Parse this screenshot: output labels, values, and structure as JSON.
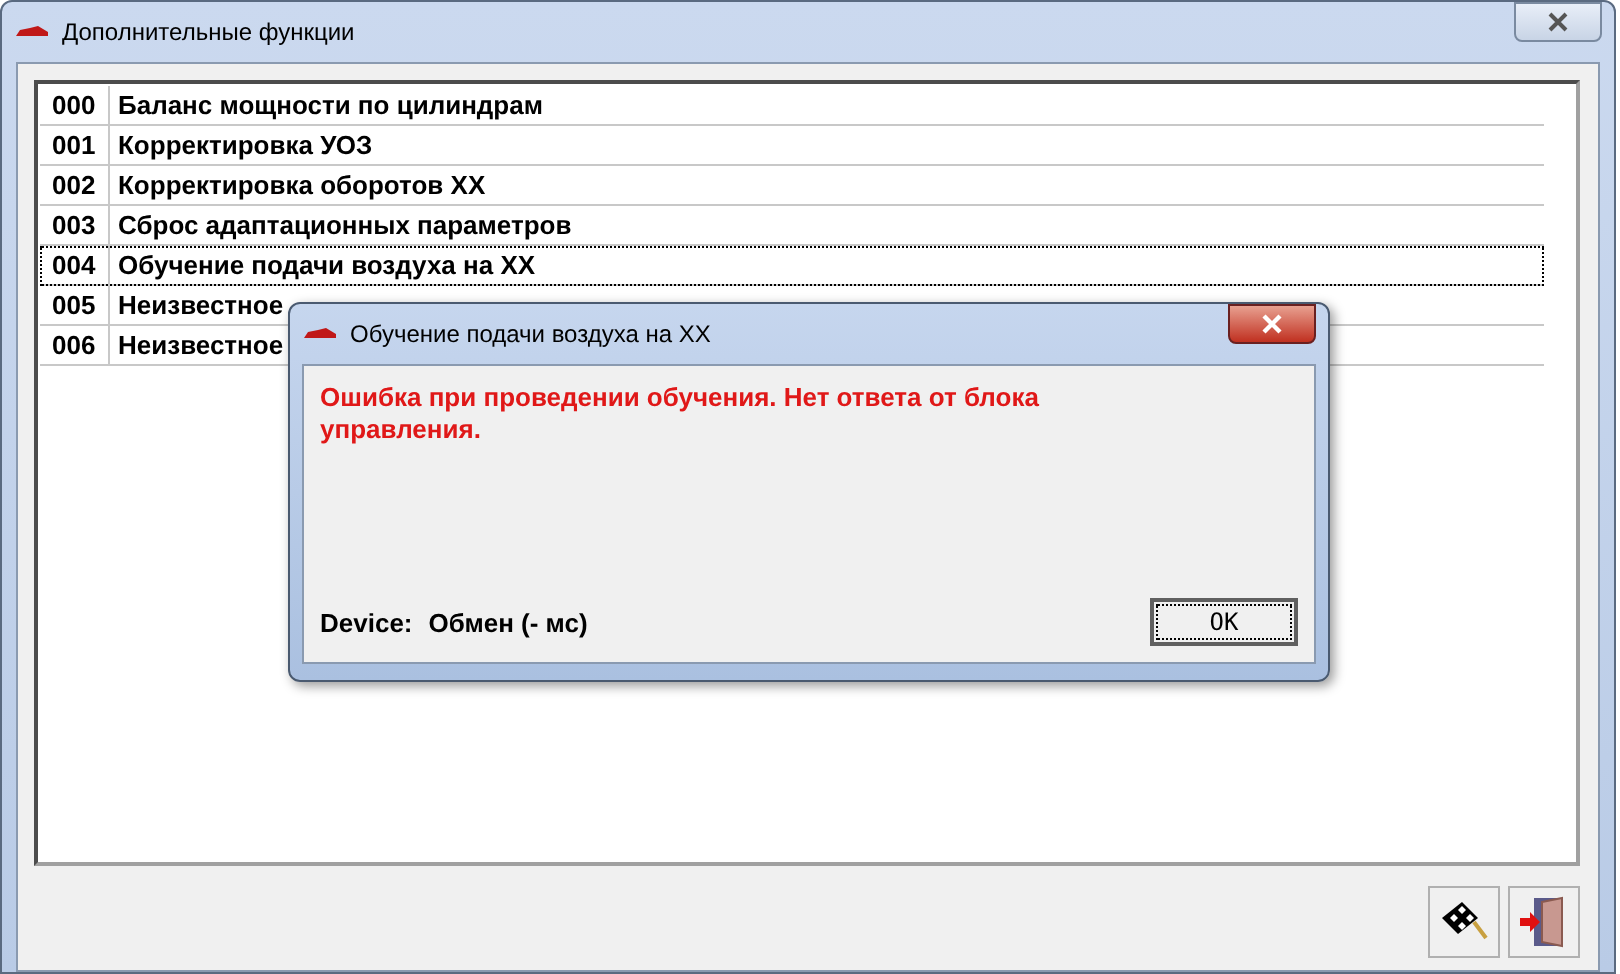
{
  "window": {
    "title": "Дополнительные функции"
  },
  "functions": [
    {
      "code": "000",
      "name": "Баланс мощности по цилиндрам",
      "selected": false
    },
    {
      "code": "001",
      "name": "Корректировка УОЗ",
      "selected": false
    },
    {
      "code": "002",
      "name": "Корректировка оборотов ХХ",
      "selected": false
    },
    {
      "code": "003",
      "name": "Сброс адаптационных параметров",
      "selected": false
    },
    {
      "code": "004",
      "name": "Обучение подачи воздуха на ХХ",
      "selected": true
    },
    {
      "code": "005",
      "name": "Неизвестное",
      "selected": false
    },
    {
      "code": "006",
      "name": "Неизвестное",
      "selected": false
    }
  ],
  "dialog": {
    "title": "Обучение подачи воздуха на ХХ",
    "message": "Ошибка при проведении обучения. Нет ответа от блока управления.",
    "device_label": "Device:",
    "device_status": "Обмен (- мс)",
    "ok_button": "OK"
  }
}
